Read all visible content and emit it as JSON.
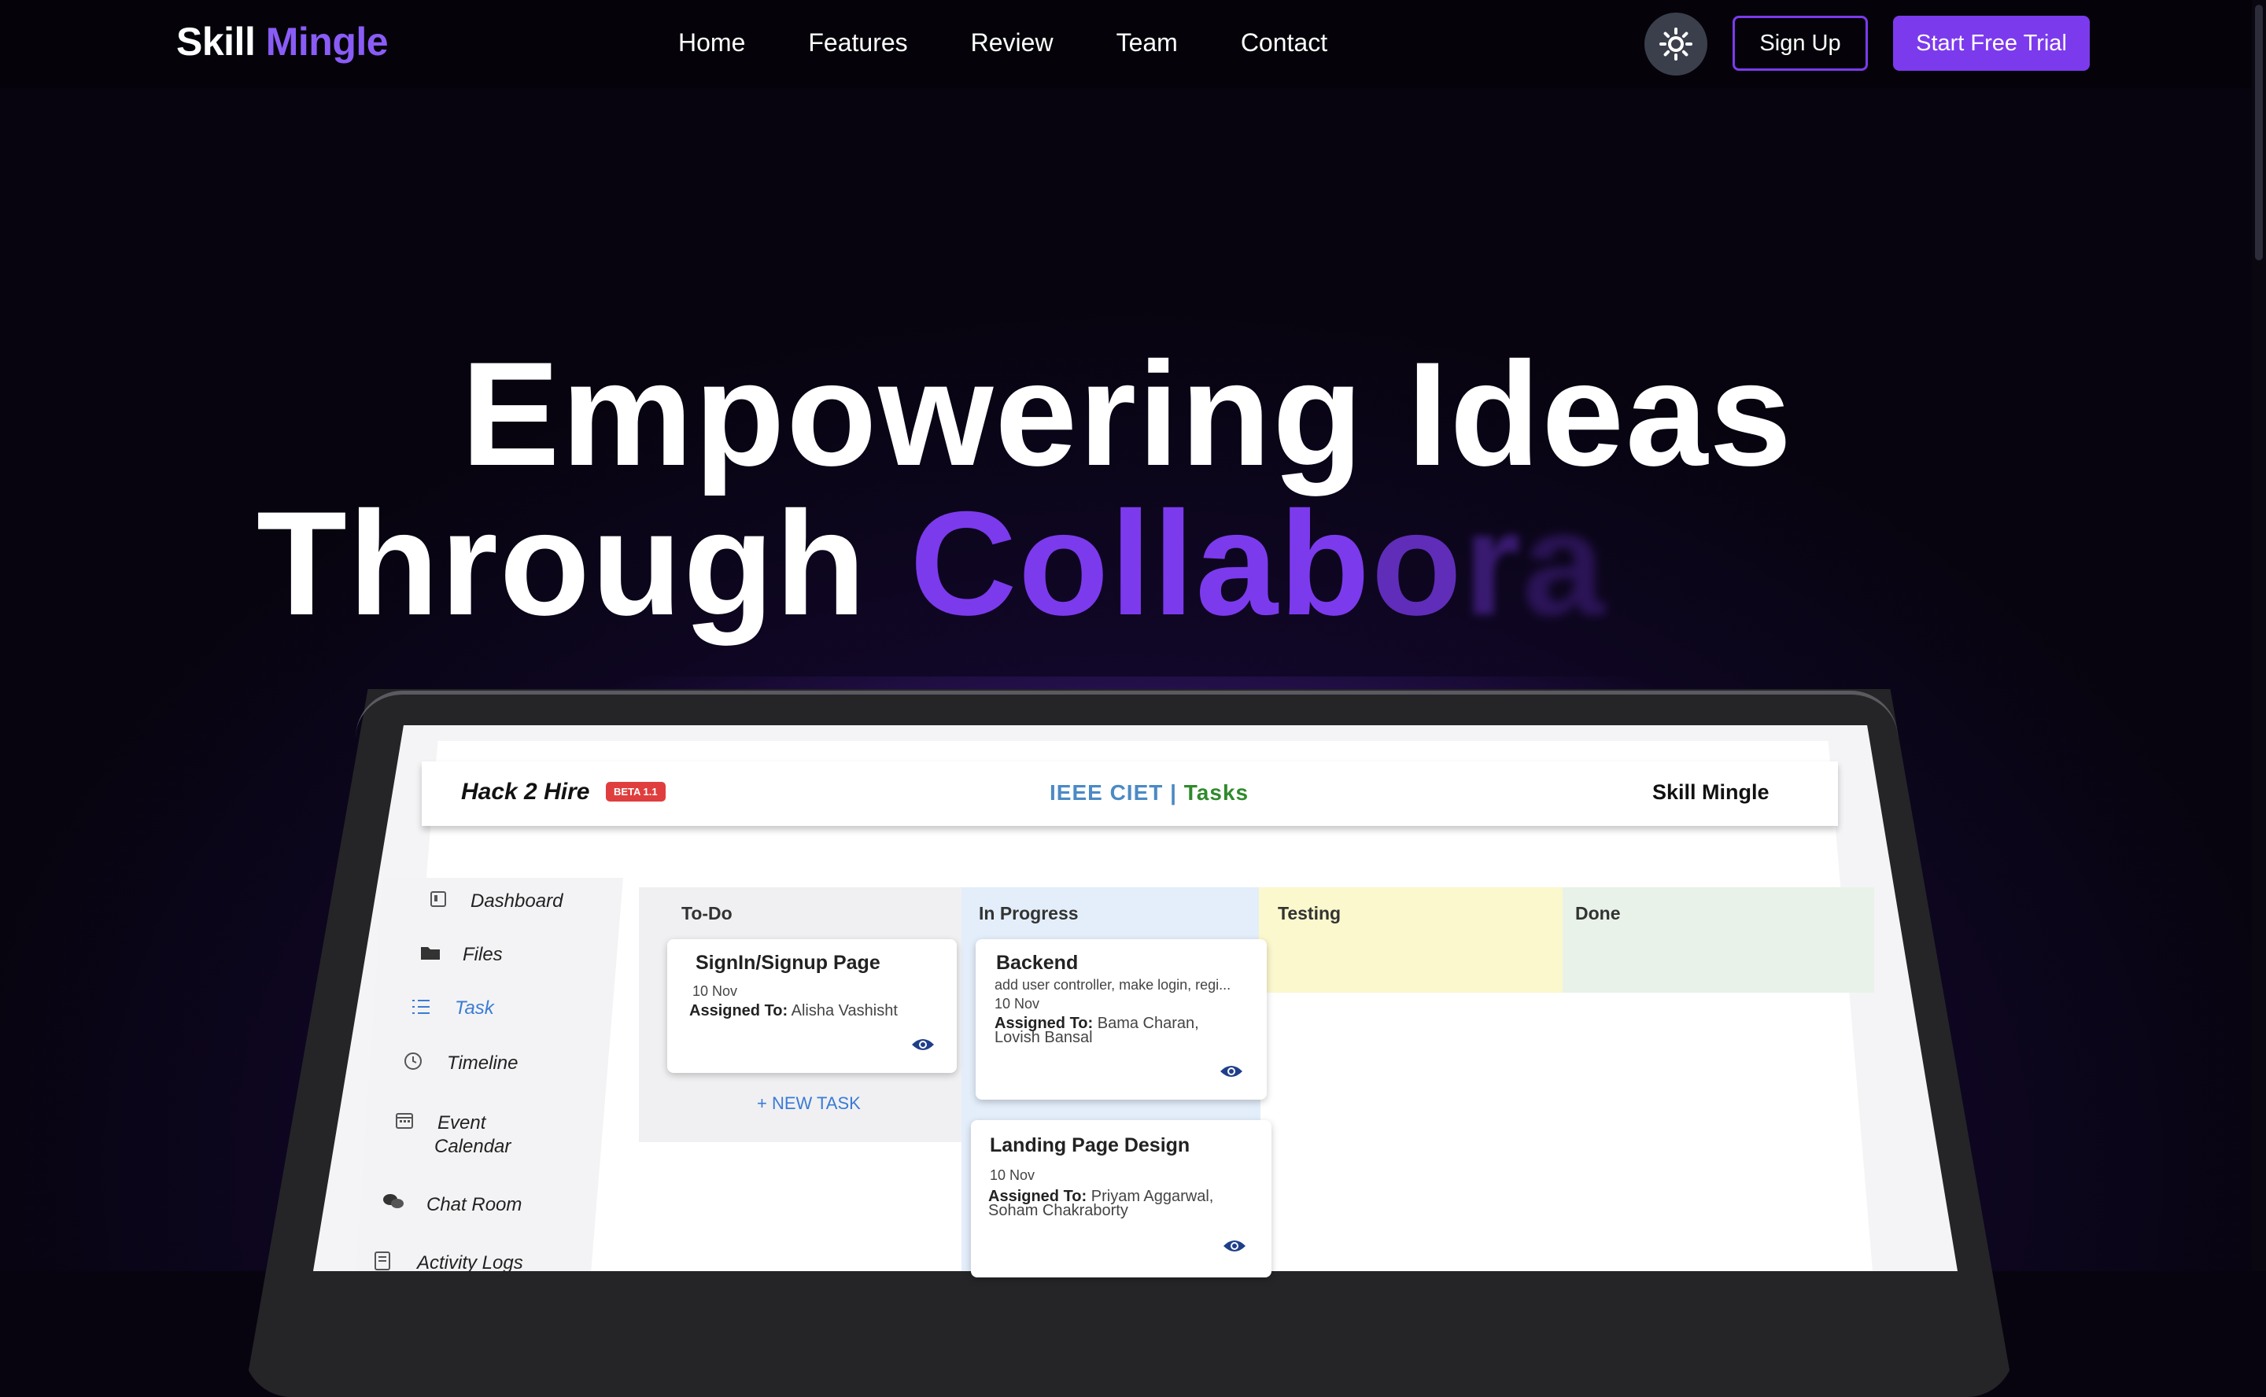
{
  "nav": {
    "logo_part1": "Skill",
    "logo_part2": "Mingle",
    "links": [
      "Home",
      "Features",
      "Review",
      "Team",
      "Contact"
    ],
    "theme_toggle_icon": "sun-icon",
    "signup_label": "Sign Up",
    "trial_label": "Start Free Trial"
  },
  "hero": {
    "line1": "Empowering Ideas",
    "line2_prefix": "Through",
    "typed_solid": "Collab",
    "typed_fade1": "o",
    "typed_fade2": "r",
    "typed_fade3": "a",
    "accent_color": "#7c3aed"
  },
  "app": {
    "brand_left": "Hack 2 Hire",
    "beta_badge": "BETA 1.1",
    "org": "IEEE CIET",
    "separator": "|",
    "section": "Tasks",
    "brand_right": "Skill Mingle",
    "sidebar": [
      {
        "label": "Dashboard",
        "icon": "dashboard-icon"
      },
      {
        "label": "Files",
        "icon": "folder-icon"
      },
      {
        "label": "Task",
        "icon": "task-list-icon",
        "active": true
      },
      {
        "label": "Timeline",
        "icon": "clock-icon"
      },
      {
        "label": "Event",
        "label2": "Calendar",
        "icon": "calendar-icon"
      },
      {
        "label": "Chat Room",
        "icon": "chat-icon"
      },
      {
        "label": "Activity Logs",
        "icon": "logs-icon"
      }
    ],
    "columns": [
      {
        "title": "To-Do",
        "color": "#f0f0f2"
      },
      {
        "title": "In Progress",
        "color": "#e3eefa"
      },
      {
        "title": "Testing",
        "color": "#fbf8cd"
      },
      {
        "title": "Done",
        "color": "#e8f2e8"
      }
    ],
    "cards": {
      "todo1": {
        "title": "SignIn/Signup Page",
        "date": "10 Nov",
        "assigned_label": "Assigned To:",
        "assigned": "Alisha Vashisht"
      },
      "prog1": {
        "title": "Backend",
        "desc": "add user controller, make login, regi...",
        "date": "10 Nov",
        "assigned_label": "Assigned To:",
        "assigned": "Bama Charan,",
        "assigned2": "Lovish Bansal"
      },
      "prog2": {
        "title": "Landing Page Design",
        "date": "10 Nov",
        "assigned_label": "Assigned To:",
        "assigned": "Priyam Aggarwal,",
        "assigned2": "Soham Chakraborty"
      }
    },
    "new_task_label": "+ NEW TASK"
  }
}
